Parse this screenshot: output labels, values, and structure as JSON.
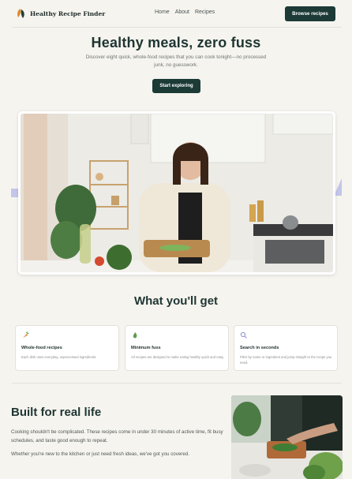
{
  "header": {
    "brand": "Healthy Recipe Finder",
    "nav": [
      "Home",
      "About",
      "Recipes"
    ],
    "cta_label": "Browse recipes",
    "logo_icon": "leaf-logo-icon"
  },
  "hero": {
    "title": "Healthy meals, zero fuss",
    "subtitle": "Discover eight quick, whole-food recipes that you can cook tonight—no processed junk, no guesswork.",
    "button_label": "Start exploring",
    "image_icon": "woman-cooking-photo"
  },
  "features": {
    "title": "What you'll get",
    "cards": [
      {
        "icon": "carrot-icon",
        "title": "Whole-food recipes",
        "text": "Each dish uses everyday, unprocessed ingredients."
      },
      {
        "icon": "flame-icon",
        "title": "Minimum fuss",
        "text": "All recipes are designed to make eating healthy quick and easy."
      },
      {
        "icon": "search-icon",
        "title": "Search in seconds",
        "text": "Filter by name or ingredient and jump straight to the recipe you need."
      }
    ]
  },
  "real_life": {
    "title": "Built for real life",
    "paragraph_1": "Cooking shouldn't be complicated. These recipes come in under 30 minutes of active time, fit busy schedules, and taste good enough to repeat.",
    "paragraph_2": "Whether you're new to the kitchen or just need fresh ideas, we've got you covered.",
    "image_icon": "chopping-vegetables-photo"
  },
  "colors": {
    "background": "#f6f4ef",
    "primary": "#1c3a36",
    "accent_lavender": "#c3c6ea"
  }
}
